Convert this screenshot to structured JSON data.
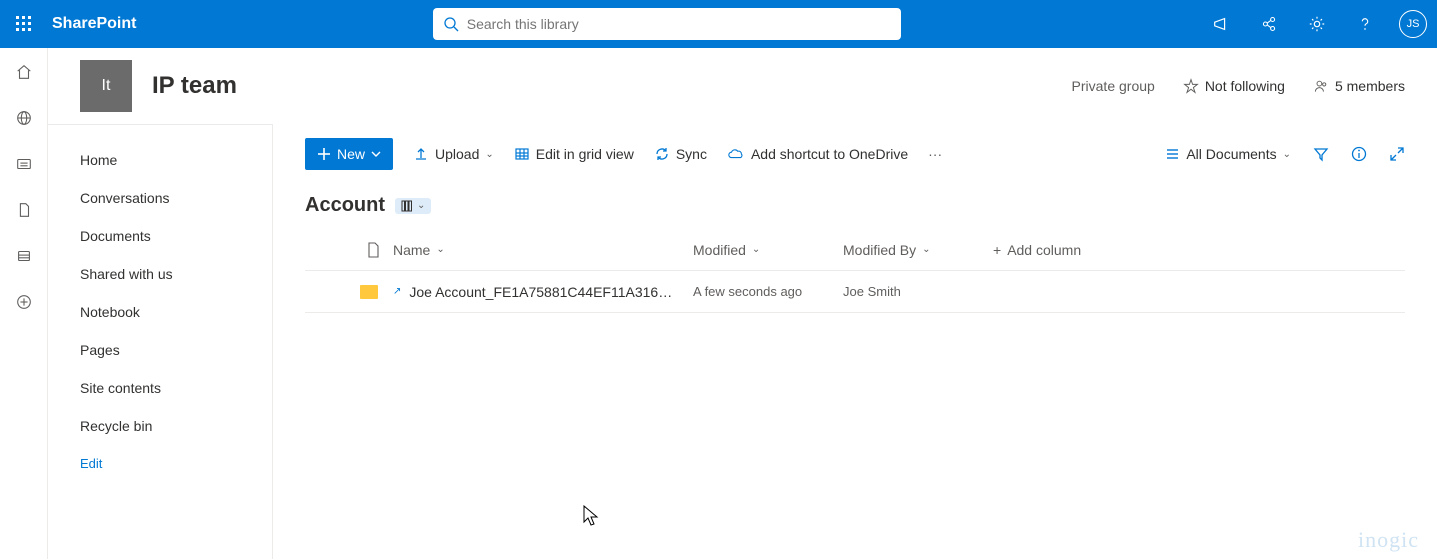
{
  "suite": {
    "brand": "SharePoint",
    "searchPlaceholder": "Search this library",
    "avatarInitials": "JS"
  },
  "site": {
    "logoInitials": "It",
    "title": "IP team",
    "privacy": "Private group",
    "followLabel": "Not following",
    "membersLabel": "5 members"
  },
  "nav": {
    "items": [
      "Home",
      "Conversations",
      "Documents",
      "Shared with us",
      "Notebook",
      "Pages",
      "Site contents",
      "Recycle bin"
    ],
    "editLabel": "Edit"
  },
  "cmd": {
    "newLabel": "New",
    "upload": "Upload",
    "editGrid": "Edit in grid view",
    "sync": "Sync",
    "addShortcut": "Add shortcut to OneDrive",
    "viewLabel": "All Documents"
  },
  "list": {
    "title": "Account"
  },
  "columns": {
    "name": "Name",
    "modified": "Modified",
    "modifiedBy": "Modified By",
    "add": "Add column"
  },
  "rows": [
    {
      "name": "Joe Account_FE1A75881C44EF11A316002…",
      "modified": "A few seconds ago",
      "modifiedBy": "Joe Smith"
    }
  ],
  "watermark": "inogic"
}
